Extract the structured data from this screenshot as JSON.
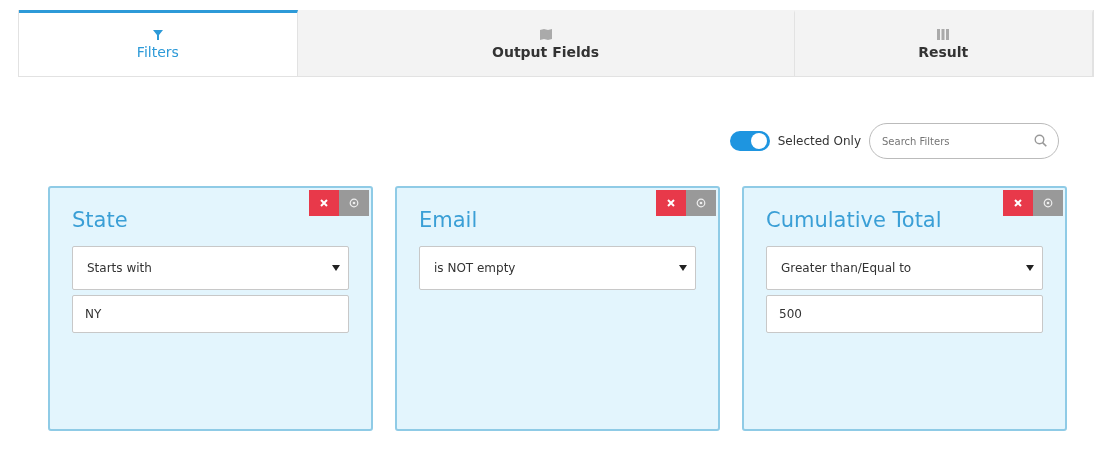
{
  "tabs": [
    {
      "label": "Filters",
      "selected": true
    },
    {
      "label": "Output Fields",
      "selected": false
    },
    {
      "label": "Result",
      "selected": false
    }
  ],
  "selected_only": {
    "label": "Selected Only",
    "on": true
  },
  "search": {
    "placeholder": "Search Filters"
  },
  "filters": [
    {
      "title": "State",
      "operator": "Starts with",
      "value": "NY"
    },
    {
      "title": "Email",
      "operator": "is NOT empty"
    },
    {
      "title": "Cumulative Total",
      "operator": "Greater than/Equal to",
      "value": "500"
    }
  ]
}
